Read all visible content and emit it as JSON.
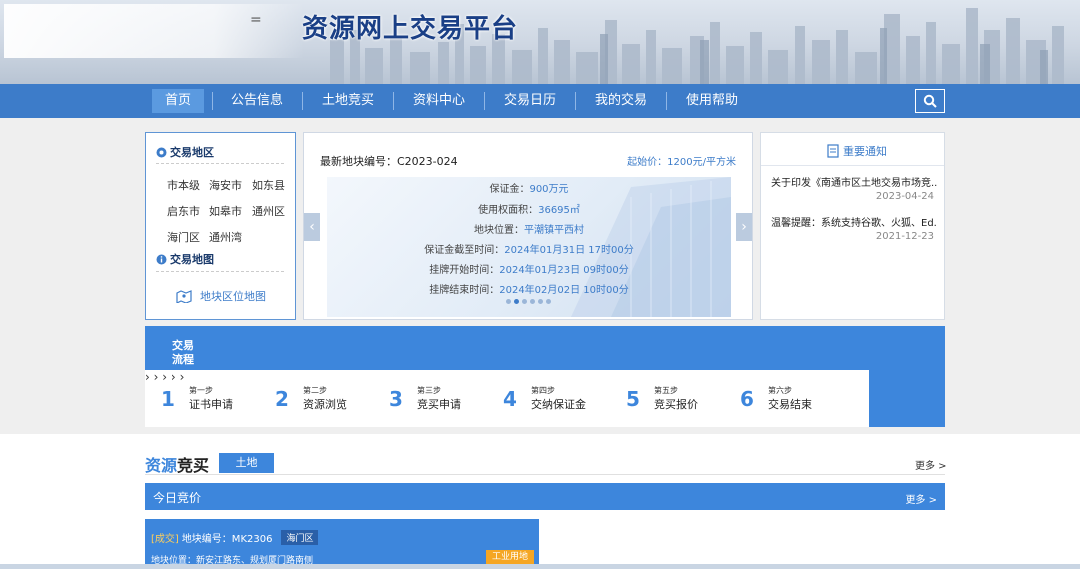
{
  "header": {
    "site_title": "资源网上交易平台",
    "dash": "="
  },
  "nav": {
    "items": [
      {
        "label": "首页",
        "active": true
      },
      {
        "label": "公告信息"
      },
      {
        "label": "土地竞买"
      },
      {
        "label": "资料中心"
      },
      {
        "label": "交易日历"
      },
      {
        "label": "我的交易"
      },
      {
        "label": "使用帮助"
      }
    ],
    "search_icon": "search-icon"
  },
  "area_panel": {
    "trade_region_heading": "交易地区",
    "regions": [
      "市本级",
      "海安市",
      "如东县",
      "启东市",
      "如皋市",
      "通州区",
      "海门区",
      "通州湾"
    ],
    "trade_map_heading": "交易地图",
    "map_link": "地块区位地图"
  },
  "carousel": {
    "latest_label": "最新地块编号：C2023-024",
    "start_price": "起始价：1200元/平方米",
    "rows": [
      {
        "label": "保证金：",
        "value": "900万元"
      },
      {
        "label": "使用权面积：",
        "value": "36695㎡"
      },
      {
        "label": "地块位置：",
        "value": "平潮镇平西村"
      },
      {
        "label": "保证金截至时间：",
        "value": "2024年01月31日 17时00分"
      },
      {
        "label": "挂牌开始时间：",
        "value": "2024年01月23日 09时00分"
      },
      {
        "label": "挂牌结束时间：",
        "value": "2024年02月02日 10时00分"
      }
    ],
    "prev": "‹",
    "next": "›",
    "page_count": 6,
    "active_page": 1
  },
  "notices": {
    "heading": "重要通知",
    "items": [
      {
        "title": "关于印发《南通市区土地交易市场竞...",
        "date": "2023-04-24"
      },
      {
        "title": "温馨提醒：系统支持谷歌、火狐、Ed...",
        "date": "2021-12-23"
      }
    ]
  },
  "process": {
    "label": "交易流程",
    "steps": [
      {
        "num": "1",
        "small": "第一步",
        "big": "证书申请"
      },
      {
        "num": "2",
        "small": "第二步",
        "big": "资源浏览"
      },
      {
        "num": "3",
        "small": "第三步",
        "big": "竞买申请"
      },
      {
        "num": "4",
        "small": "第四步",
        "big": "交纳保证金"
      },
      {
        "num": "5",
        "small": "第五步",
        "big": "竞买报价"
      },
      {
        "num": "6",
        "small": "第六步",
        "big": "交易结束"
      }
    ]
  },
  "resources": {
    "title_part1": "资源",
    "title_part2": "竞买",
    "tab": "土地",
    "more": "更多 >"
  },
  "today": {
    "title": "今日竞价",
    "more": "更多 >"
  },
  "parcel": {
    "status": "[成交]",
    "code_label": "地块编号：MK2306",
    "district": "海门区",
    "location": "地块位置：新安江路东、规划厦门路南侧",
    "use_tag": "工业用地"
  },
  "colors": {
    "primary": "#3d7cc9",
    "accent_blue": "#3d86dc",
    "deal": "#ffcf5a",
    "tag_orange": "#f5a623"
  }
}
